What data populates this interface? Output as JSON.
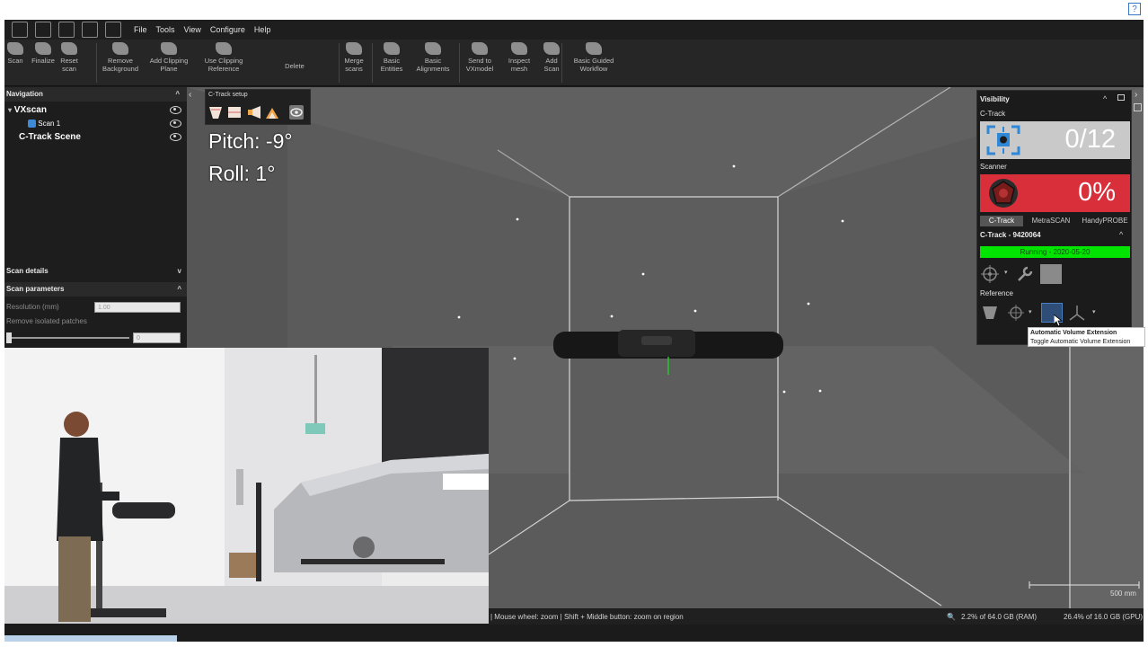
{
  "menu": {
    "items": [
      "File",
      "Tools",
      "View",
      "Configure",
      "Help"
    ]
  },
  "ribbon": {
    "buttons": [
      {
        "label": "Scan",
        "name": "scan-button"
      },
      {
        "label": "Finalize",
        "name": "finalize-button"
      },
      {
        "label": "Reset\nscan",
        "name": "reset-scan-button"
      },
      {
        "label": "Remove\nBackground",
        "name": "remove-background-button"
      },
      {
        "label": "Add Clipping\nPlane",
        "name": "add-clipping-plane-button"
      },
      {
        "label": "Use Clipping\nReference",
        "name": "use-clipping-reference-button"
      },
      {
        "label": "Delete",
        "name": "delete-button"
      },
      {
        "label": "Merge\nscans",
        "name": "merge-scans-button"
      },
      {
        "label": "Basic\nEntities",
        "name": "basic-entities-button"
      },
      {
        "label": "Basic\nAlignments",
        "name": "basic-alignments-button"
      },
      {
        "label": "Send to\nVXmodel",
        "name": "send-to-vxmodel-button"
      },
      {
        "label": "Inspect\nmesh",
        "name": "inspect-mesh-button"
      },
      {
        "label": "Add\nScan",
        "name": "add-scan-button"
      },
      {
        "label": "Basic Guided\nWorkflow",
        "name": "basic-guided-workflow-button"
      }
    ]
  },
  "navigation": {
    "title": "Navigation",
    "items": [
      {
        "label": "VXscan"
      },
      {
        "label": "Scan 1"
      },
      {
        "label": "C-Track Scene"
      }
    ]
  },
  "scan_details": {
    "title": "Scan details"
  },
  "scan_parameters": {
    "title": "Scan parameters",
    "resolution_label": "Resolution (mm)",
    "resolution_value": "1.00",
    "remove_isolated_label": "Remove isolated patches",
    "remove_isolated_value": "0",
    "remove_isolated_fraction": 0.0
  },
  "ctrack_setup": {
    "title": "C-Track setup"
  },
  "pose": {
    "pitch": "Pitch: -9°",
    "roll": "Roll: 1°"
  },
  "visibility": {
    "title": "Visibility",
    "ctrack_label": "C-Track",
    "ctrack_count": "0/12",
    "scanner_label": "Scanner",
    "scanner_percent": "0%",
    "tabs": [
      "C-Track",
      "MetraSCAN",
      "HandyPROBE"
    ],
    "device_title": "C-Track - 9420064",
    "running_status": "Running - 2020-05-20",
    "reference_label": "Reference",
    "colors": {
      "ctrack_bg": "#c9c9c9",
      "scanner_bg": "#d92f3a",
      "running_bg": "#00e400"
    }
  },
  "tooltip": {
    "title": "Automatic Volume Extension",
    "desc": "Toggle Automatic Volume Extension"
  },
  "status": {
    "hint": "| Mouse wheel: zoom  |  Shift + Middle button: zoom on region",
    "ram": "2.2% of 64.0 GB (RAM)",
    "gpu": "26.4% of 16.0 GB (GPU)",
    "scale": "500 mm"
  }
}
